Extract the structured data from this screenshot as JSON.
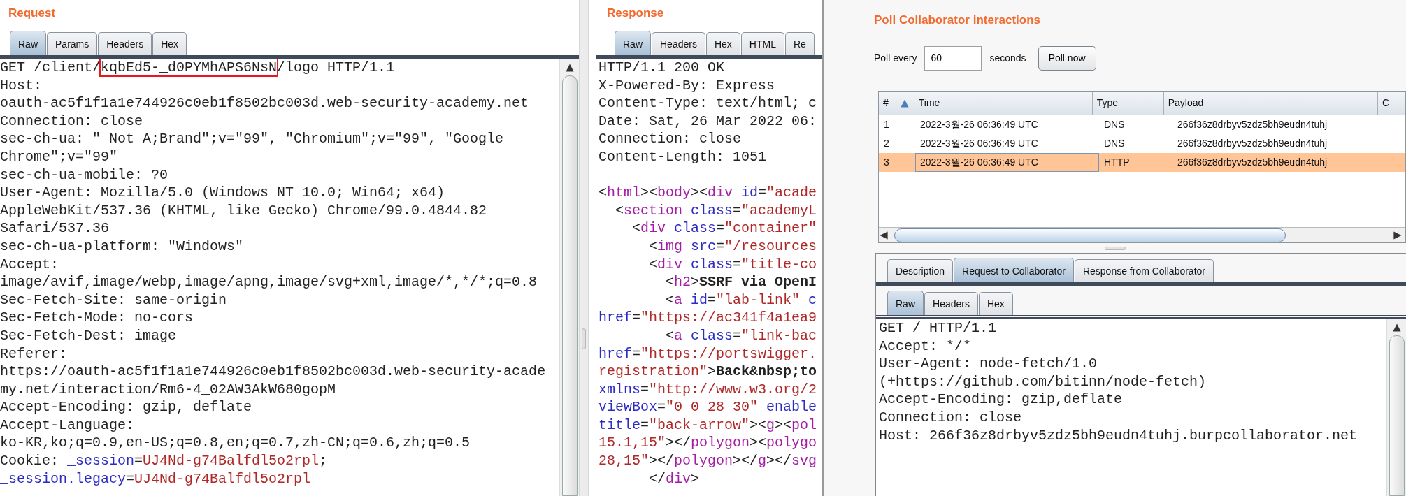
{
  "request": {
    "title": "Request",
    "tabs": [
      {
        "label": "Raw",
        "selected": true
      },
      {
        "label": "Params",
        "selected": false
      },
      {
        "label": "Headers",
        "selected": false
      },
      {
        "label": "Hex",
        "selected": false
      }
    ],
    "lines": [
      {
        "kind": "parts",
        "parts": [
          {
            "kind": "plain",
            "text": "GET /client/"
          },
          {
            "kind": "boxed",
            "text": "kqbEd5-_d0PYMhAPS6NsN"
          },
          {
            "kind": "plain",
            "text": "/logo HTTP/1.1"
          }
        ]
      },
      {
        "kind": "text",
        "text": "Host:"
      },
      {
        "kind": "text",
        "text": "oauth-ac5f1f1a1e744926c0eb1f8502bc003d.web-security-academy.net"
      },
      {
        "kind": "text",
        "text": "Connection: close"
      },
      {
        "kind": "text",
        "text": "sec-ch-ua: \" Not A;Brand\";v=\"99\", \"Chromium\";v=\"99\", \"Google"
      },
      {
        "kind": "text",
        "text": "Chrome\";v=\"99\""
      },
      {
        "kind": "text",
        "text": "sec-ch-ua-mobile: ?0"
      },
      {
        "kind": "text",
        "text": "User-Agent: Mozilla/5.0 (Windows NT 10.0; Win64; x64)"
      },
      {
        "kind": "text",
        "text": "AppleWebKit/537.36 (KHTML, like Gecko) Chrome/99.0.4844.82"
      },
      {
        "kind": "text",
        "text": "Safari/537.36"
      },
      {
        "kind": "text",
        "text": "sec-ch-ua-platform: \"Windows\""
      },
      {
        "kind": "text",
        "text": "Accept:"
      },
      {
        "kind": "text",
        "text": "image/avif,image/webp,image/apng,image/svg+xml,image/*,*/*;q=0.8"
      },
      {
        "kind": "text",
        "text": "Sec-Fetch-Site: same-origin"
      },
      {
        "kind": "text",
        "text": "Sec-Fetch-Mode: no-cors"
      },
      {
        "kind": "text",
        "text": "Sec-Fetch-Dest: image"
      },
      {
        "kind": "text",
        "text": "Referer:"
      },
      {
        "kind": "text",
        "text": "https://oauth-ac5f1f1a1e744926c0eb1f8502bc003d.web-security-acade"
      },
      {
        "kind": "text",
        "text": "my.net/interaction/Rm6-4_02AW3AkW680gopM"
      },
      {
        "kind": "text",
        "text": "Accept-Encoding: gzip, deflate"
      },
      {
        "kind": "text",
        "text": "Accept-Language:"
      },
      {
        "kind": "text",
        "text": "ko-KR,ko;q=0.9,en-US;q=0.8,en;q=0.7,zh-CN;q=0.6,zh;q=0.5"
      },
      {
        "kind": "parts",
        "parts": [
          {
            "kind": "plain",
            "text": "Cookie: "
          },
          {
            "kind": "name",
            "text": "_session"
          },
          {
            "kind": "plain",
            "text": "="
          },
          {
            "kind": "value",
            "text": "UJ4Nd-g74Balfdl5o2rpl"
          },
          {
            "kind": "plain",
            "text": ";"
          }
        ]
      },
      {
        "kind": "parts",
        "parts": [
          {
            "kind": "name",
            "text": "_session.legacy"
          },
          {
            "kind": "plain",
            "text": "="
          },
          {
            "kind": "value",
            "text": "UJ4Nd-g74Balfdl5o2rpl"
          }
        ]
      }
    ]
  },
  "response": {
    "title": "Response",
    "tabs": [
      {
        "label": "Raw",
        "selected": true
      },
      {
        "label": "Headers",
        "selected": false
      },
      {
        "label": "Hex",
        "selected": false
      },
      {
        "label": "HTML",
        "selected": false
      },
      {
        "label": "Re",
        "selected": false
      }
    ],
    "lines": [
      {
        "kind": "text",
        "text": "HTTP/1.1 200 OK"
      },
      {
        "kind": "text",
        "text": "X-Powered-By: Express"
      },
      {
        "kind": "text",
        "text": "Content-Type: text/html; c"
      },
      {
        "kind": "text",
        "text": "Date: Sat, 26 Mar 2022 06:"
      },
      {
        "kind": "text",
        "text": "Connection: close"
      },
      {
        "kind": "text",
        "text": "Content-Length: 1051"
      },
      {
        "kind": "blank"
      },
      {
        "kind": "parts",
        "parts": [
          {
            "kind": "plain",
            "text": "<"
          },
          {
            "kind": "tag",
            "text": "html"
          },
          {
            "kind": "plain",
            "text": "><"
          },
          {
            "kind": "tag",
            "text": "body"
          },
          {
            "kind": "plain",
            "text": "><"
          },
          {
            "kind": "tag",
            "text": "div"
          },
          {
            "kind": "name",
            "text": " id"
          },
          {
            "kind": "plain",
            "text": "="
          },
          {
            "kind": "value",
            "text": "\"acade"
          }
        ]
      },
      {
        "kind": "parts",
        "parts": [
          {
            "kind": "plain",
            "text": "  <"
          },
          {
            "kind": "tag",
            "text": "section"
          },
          {
            "kind": "name",
            "text": " class"
          },
          {
            "kind": "plain",
            "text": "="
          },
          {
            "kind": "value",
            "text": "\"academyL"
          }
        ]
      },
      {
        "kind": "parts",
        "parts": [
          {
            "kind": "plain",
            "text": "    <"
          },
          {
            "kind": "tag",
            "text": "div"
          },
          {
            "kind": "name",
            "text": " class"
          },
          {
            "kind": "plain",
            "text": "="
          },
          {
            "kind": "value",
            "text": "\"container\""
          }
        ]
      },
      {
        "kind": "parts",
        "parts": [
          {
            "kind": "plain",
            "text": "      <"
          },
          {
            "kind": "tag",
            "text": "img"
          },
          {
            "kind": "name",
            "text": " src"
          },
          {
            "kind": "plain",
            "text": "="
          },
          {
            "kind": "value",
            "text": "\"/resources"
          }
        ]
      },
      {
        "kind": "parts",
        "parts": [
          {
            "kind": "plain",
            "text": "      <"
          },
          {
            "kind": "tag",
            "text": "div"
          },
          {
            "kind": "name",
            "text": " class"
          },
          {
            "kind": "plain",
            "text": "="
          },
          {
            "kind": "value",
            "text": "\"title-co"
          }
        ]
      },
      {
        "kind": "parts",
        "parts": [
          {
            "kind": "plain",
            "text": "        <"
          },
          {
            "kind": "tag",
            "text": "h2"
          },
          {
            "kind": "plain",
            "text": ">"
          },
          {
            "kind": "bold",
            "text": "SSRF via OpenI"
          }
        ]
      },
      {
        "kind": "parts",
        "parts": [
          {
            "kind": "plain",
            "text": "        <"
          },
          {
            "kind": "tag",
            "text": "a"
          },
          {
            "kind": "name",
            "text": " id"
          },
          {
            "kind": "plain",
            "text": "="
          },
          {
            "kind": "value",
            "text": "\"lab-link\""
          },
          {
            "kind": "name",
            "text": " c"
          }
        ]
      },
      {
        "kind": "parts",
        "parts": [
          {
            "kind": "name",
            "text": "href"
          },
          {
            "kind": "plain",
            "text": "="
          },
          {
            "kind": "value",
            "text": "\"https://ac341f4a1ea9"
          }
        ]
      },
      {
        "kind": "parts",
        "parts": [
          {
            "kind": "plain",
            "text": "        <"
          },
          {
            "kind": "tag",
            "text": "a"
          },
          {
            "kind": "name",
            "text": " class"
          },
          {
            "kind": "plain",
            "text": "="
          },
          {
            "kind": "value",
            "text": "\"link-bac"
          }
        ]
      },
      {
        "kind": "parts",
        "parts": [
          {
            "kind": "name",
            "text": "href"
          },
          {
            "kind": "plain",
            "text": "="
          },
          {
            "kind": "value",
            "text": "\"https://portswigger."
          }
        ]
      },
      {
        "kind": "parts",
        "parts": [
          {
            "kind": "value",
            "text": "registration\""
          },
          {
            "kind": "plain",
            "text": ">"
          },
          {
            "kind": "bold",
            "text": "Back&nbsp;to"
          }
        ]
      },
      {
        "kind": "parts",
        "parts": [
          {
            "kind": "name",
            "text": "xmlns"
          },
          {
            "kind": "plain",
            "text": "="
          },
          {
            "kind": "value",
            "text": "\"http://www.w3.org/2"
          }
        ]
      },
      {
        "kind": "parts",
        "parts": [
          {
            "kind": "name",
            "text": "viewBox"
          },
          {
            "kind": "plain",
            "text": "="
          },
          {
            "kind": "value",
            "text": "\"0 0 28 30\""
          },
          {
            "kind": "name",
            "text": " enable"
          }
        ]
      },
      {
        "kind": "parts",
        "parts": [
          {
            "kind": "name",
            "text": "title"
          },
          {
            "kind": "plain",
            "text": "="
          },
          {
            "kind": "value",
            "text": "\"back-arrow\""
          },
          {
            "kind": "plain",
            "text": "><"
          },
          {
            "kind": "tag",
            "text": "g"
          },
          {
            "kind": "plain",
            "text": "><"
          },
          {
            "kind": "tag",
            "text": "pol"
          }
        ]
      },
      {
        "kind": "parts",
        "parts": [
          {
            "kind": "value",
            "text": "15.1,15\""
          },
          {
            "kind": "plain",
            "text": "></"
          },
          {
            "kind": "tag",
            "text": "polygon"
          },
          {
            "kind": "plain",
            "text": "><"
          },
          {
            "kind": "tag",
            "text": "polygo"
          }
        ]
      },
      {
        "kind": "parts",
        "parts": [
          {
            "kind": "value",
            "text": "28,15\""
          },
          {
            "kind": "plain",
            "text": "></"
          },
          {
            "kind": "tag",
            "text": "polygon"
          },
          {
            "kind": "plain",
            "text": "></"
          },
          {
            "kind": "tag",
            "text": "g"
          },
          {
            "kind": "plain",
            "text": "></"
          },
          {
            "kind": "tag",
            "text": "svg"
          }
        ]
      },
      {
        "kind": "parts",
        "parts": [
          {
            "kind": "plain",
            "text": "      </"
          },
          {
            "kind": "tag",
            "text": "div"
          },
          {
            "kind": "plain",
            "text": ">"
          }
        ]
      }
    ]
  },
  "collaborator": {
    "title": "Poll Collaborator interactions",
    "poll_label": "Poll every",
    "poll_value": "60",
    "poll_unit": "seconds",
    "poll_button": "Poll now",
    "table": {
      "columns": [
        {
          "label": "#",
          "sorted": true
        },
        {
          "label": "Time",
          "sorted": false
        },
        {
          "label": "Type",
          "sorted": false
        },
        {
          "label": "Payload",
          "sorted": false
        },
        {
          "label": "C",
          "sorted": false
        }
      ],
      "rows": [
        {
          "selected": false,
          "cells": [
            {
              "text": "1",
              "focused": false
            },
            {
              "text": "2022-3월-26 06:36:49 UTC",
              "focused": false
            },
            {
              "text": "DNS",
              "focused": false
            },
            {
              "text": "266f36z8drbyv5zdz5bh9eudn4tuhj",
              "focused": false
            }
          ]
        },
        {
          "selected": false,
          "cells": [
            {
              "text": "2",
              "focused": false
            },
            {
              "text": "2022-3월-26 06:36:49 UTC",
              "focused": false
            },
            {
              "text": "DNS",
              "focused": false
            },
            {
              "text": "266f36z8drbyv5zdz5bh9eudn4tuhj",
              "focused": false
            }
          ]
        },
        {
          "selected": true,
          "cells": [
            {
              "text": "3",
              "focused": false
            },
            {
              "text": "2022-3월-26 06:36:49 UTC",
              "focused": true
            },
            {
              "text": "HTTP",
              "focused": false
            },
            {
              "text": "266f36z8drbyv5zdz5bh9eudn4tuhj",
              "focused": false
            }
          ]
        }
      ]
    },
    "detail_tabs": [
      {
        "label": "Description",
        "selected": false
      },
      {
        "label": "Request to Collaborator",
        "selected": true
      },
      {
        "label": "Response from Collaborator",
        "selected": false
      }
    ],
    "view_tabs": [
      {
        "label": "Raw",
        "selected": true
      },
      {
        "label": "Headers",
        "selected": false
      },
      {
        "label": "Hex",
        "selected": false
      }
    ],
    "lines": [
      {
        "kind": "text",
        "text": "GET / HTTP/1.1"
      },
      {
        "kind": "text",
        "text": "Accept: */*"
      },
      {
        "kind": "text",
        "text": "User-Agent: node-fetch/1.0"
      },
      {
        "kind": "text",
        "text": "(+https://github.com/bitinn/node-fetch)"
      },
      {
        "kind": "text",
        "text": "Accept-Encoding: gzip,deflate"
      },
      {
        "kind": "text",
        "text": "Connection: close"
      },
      {
        "kind": "text",
        "text": "Host: 266f36z8drbyv5zdz5bh9eudn4tuhj.burpcollaborator.net"
      }
    ]
  }
}
